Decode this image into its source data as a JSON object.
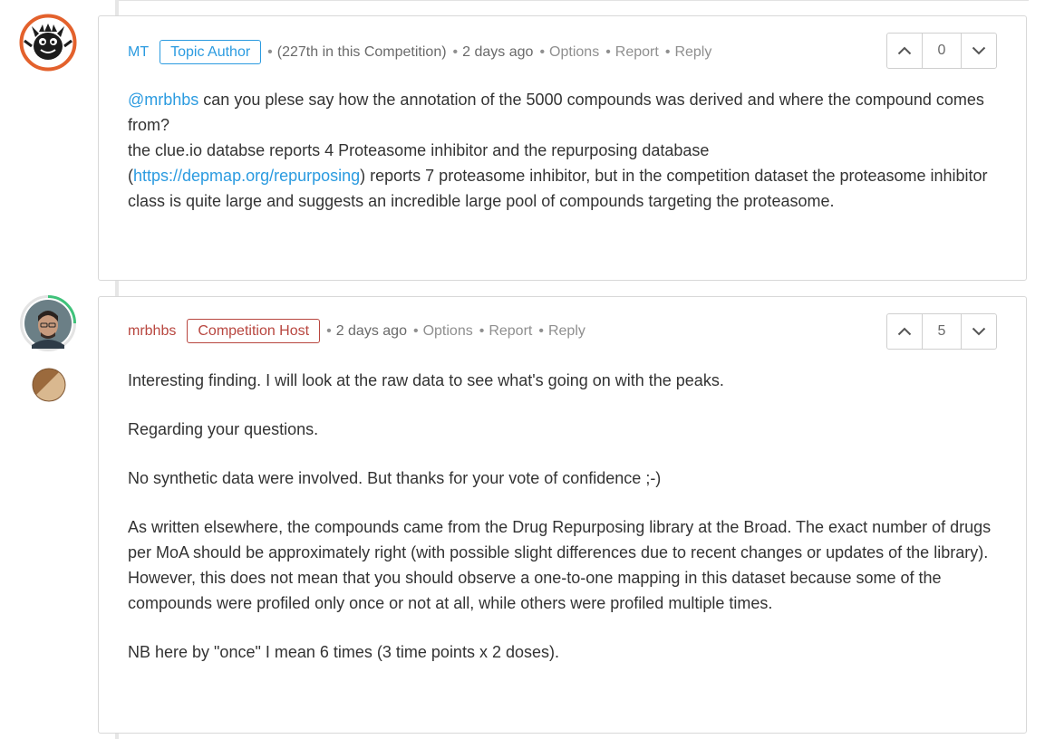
{
  "comments": [
    {
      "author": "MT",
      "badge": "Topic Author",
      "rank": "(227th in this Competition)",
      "time": "2 days ago",
      "actions": [
        "Options",
        "Report",
        "Reply"
      ],
      "votes": "0",
      "body": {
        "mention": "@mrbhbs",
        "l1_rest": " can you plese say how the annotation of the 5000 compounds was derived and where the compound comes from?",
        "l2": "the clue.io databse reports 4 Proteasome inhibitor and the repurposing database",
        "l3_open": "(",
        "link": "https://depmap.org/repurposing",
        "l3_rest": ") reports 7 proteasome inhibitor, but in the competition dataset the proteasome inhibitor class is quite large and suggests an incredible large pool of compounds targeting the proteasome."
      }
    },
    {
      "author": "mrbhbs",
      "badge": "Competition Host",
      "time": "2 days ago",
      "actions": [
        "Options",
        "Report",
        "Reply"
      ],
      "votes": "5",
      "paragraphs": [
        "Interesting finding. I will look at the raw data to see what's going on with the peaks.",
        "Regarding your questions.",
        "No synthetic data were involved. But thanks for your vote of confidence ;-)",
        "As written elsewhere, the compounds came from the Drug Repurposing library at the Broad. The exact number of drugs per MoA should be approximately right (with possible slight differences due to recent changes or updates of the library).",
        "However, this does not mean that you should observe a one-to-one mapping in this dataset because some of the compounds were profiled only once or not at all, while others were profiled multiple times.",
        "NB here by \"once\" I mean 6 times (3 time points x 2 doses)."
      ]
    }
  ],
  "icons": {
    "upvote": "chevron-up-icon",
    "downvote": "chevron-down-icon",
    "medal": "bronze-medal-icon"
  },
  "colors": {
    "link": "#2b9be0",
    "host": "#b8463f",
    "avatar_ring_orange": "#e3612c",
    "avatar_ring_green": "#3fc27a",
    "medal": "#9b6a3d"
  }
}
